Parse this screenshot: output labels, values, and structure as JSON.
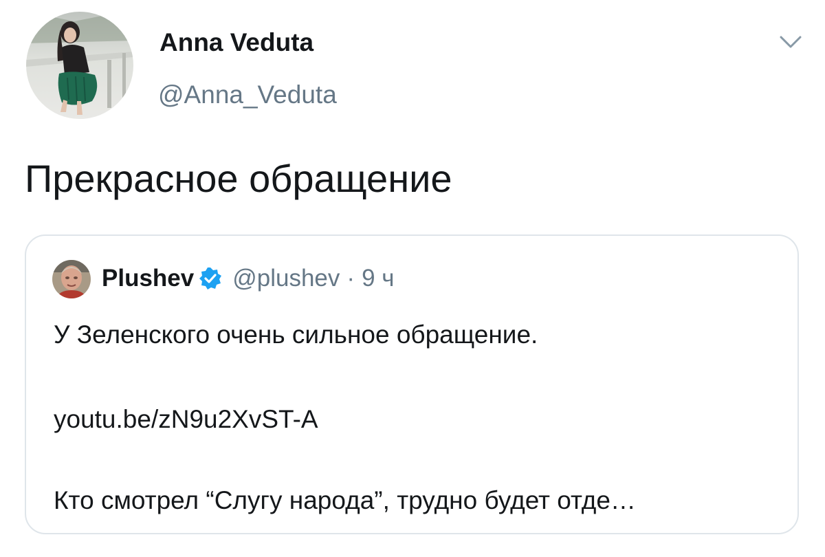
{
  "tweet": {
    "author": {
      "name": "Anna Veduta",
      "handle": "@Anna_Veduta",
      "avatar_icon": "user-photo-avatar"
    },
    "menu_icon": "chevron-down-icon",
    "text": "Прекрасное обращение"
  },
  "quote": {
    "author": {
      "name": "Plushev",
      "handle": "@plushev",
      "separator": "·",
      "time": "9 ч",
      "verified": true,
      "avatar_icon": "user-photo-avatar"
    },
    "lines": [
      "У Зеленского очень сильное обращение.",
      "youtu.be/zN9u2XvST-A",
      "Кто смотрел “Слугу народа”, трудно будет отде…"
    ]
  },
  "colors": {
    "text_primary": "#14171a",
    "text_secondary": "#657786",
    "card_border": "#dfe5ea",
    "verified_blue": "#1da1f2"
  }
}
